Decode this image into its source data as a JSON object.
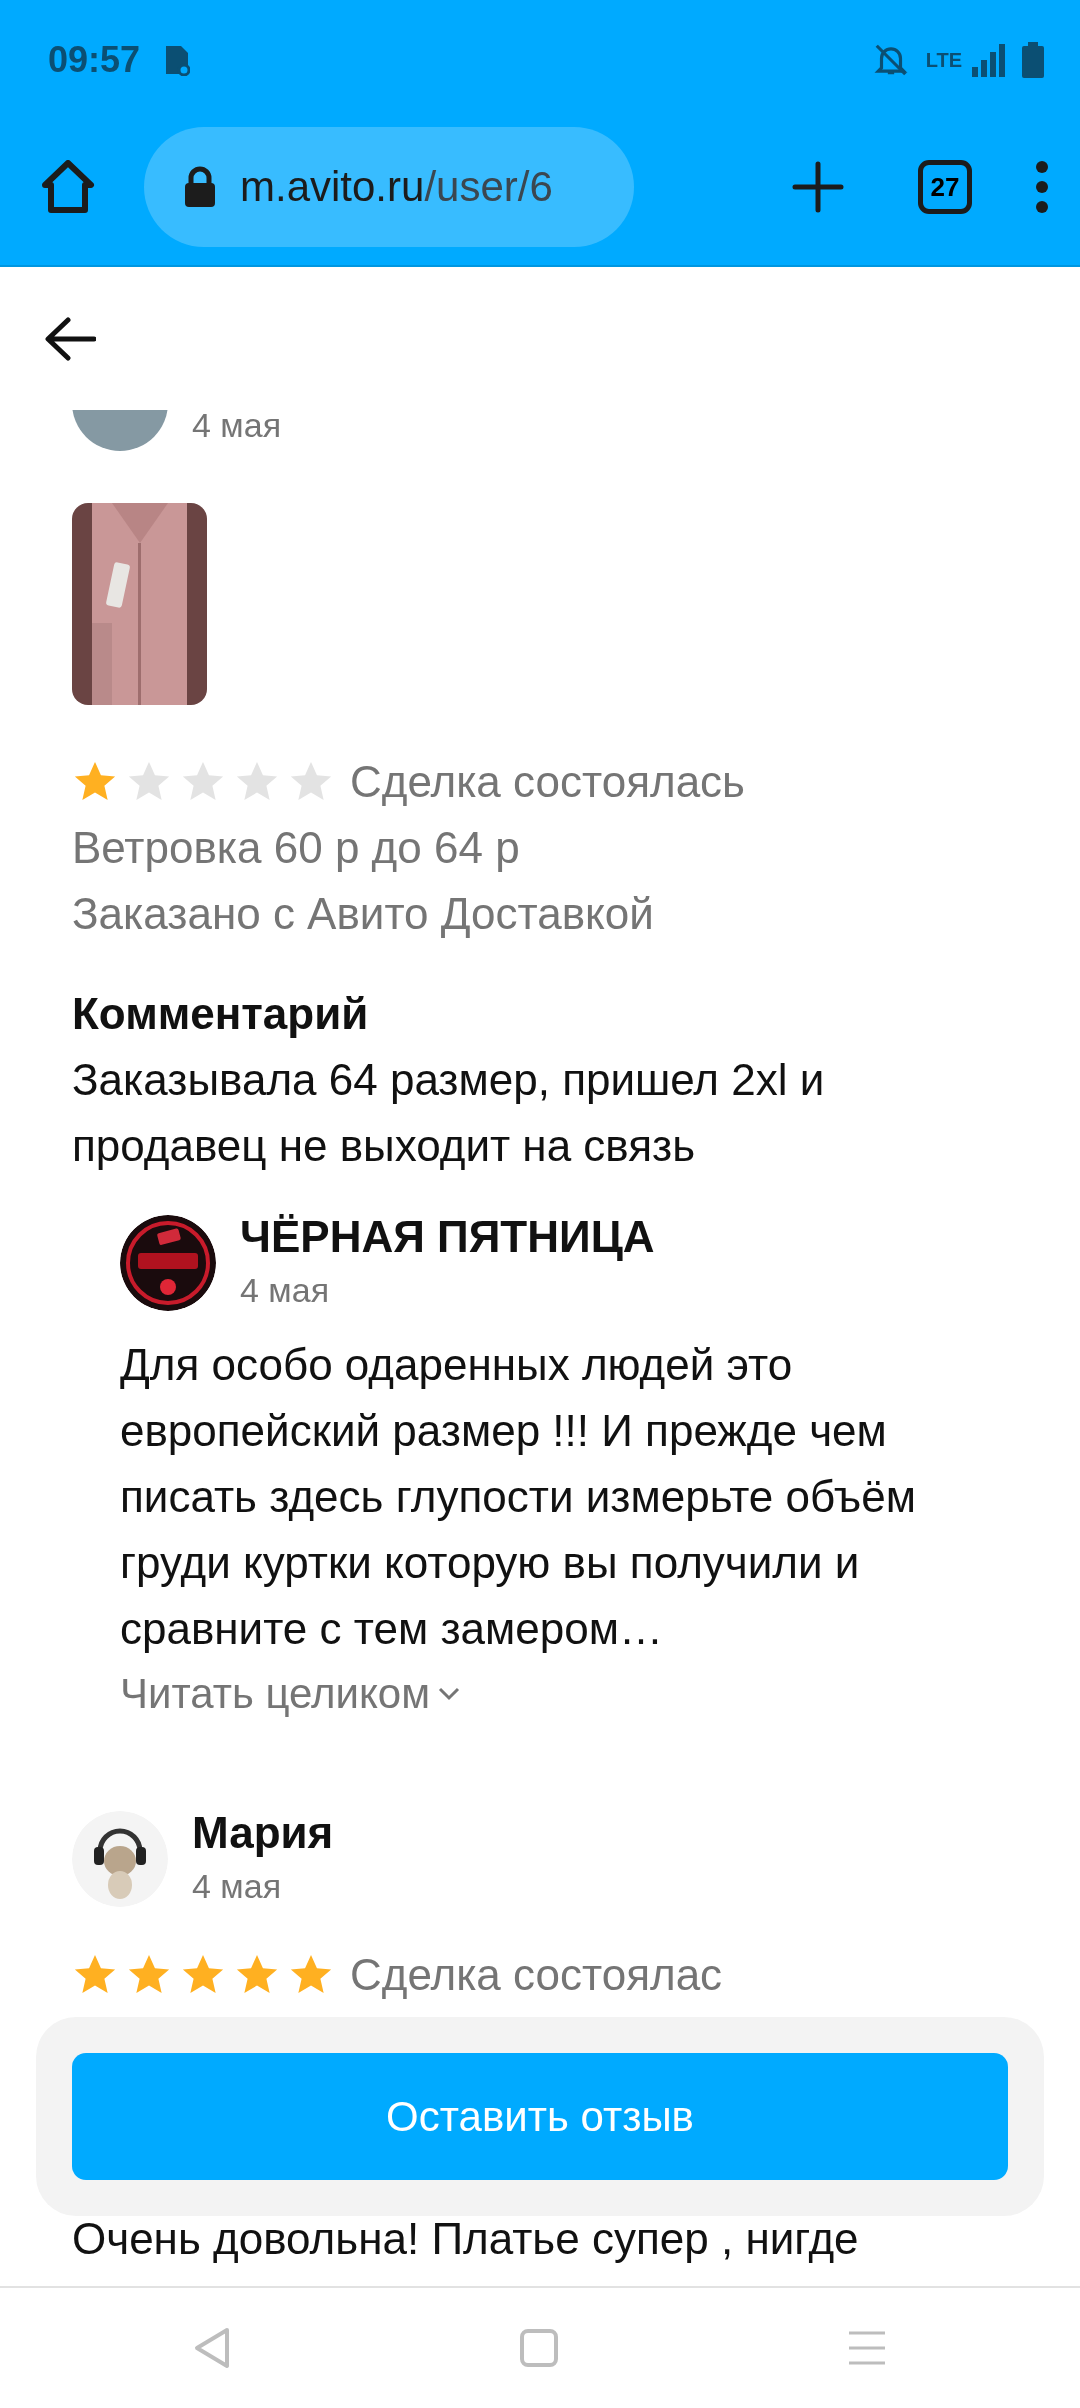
{
  "status_bar": {
    "time": "09:57",
    "network": "LTE"
  },
  "browser": {
    "url_host": "m.avito.ru",
    "url_path": "/user/6",
    "tab_count": "27"
  },
  "reviews": [
    {
      "avatar": {
        "kind": "letter"
      },
      "date": "4 мая",
      "photos": [
        {
          "kind": "picture"
        }
      ],
      "stars": 1,
      "status": "Сделка состоялась",
      "item": "Ветровка 60 р до 64 р",
      "delivery": "Заказано с Авито Доставкой",
      "comment_label": "Комментарий",
      "comment": "Заказывала 64 размер, пришел 2xl и продавец не выходит на связь",
      "reply": {
        "name": "ЧЁРНАЯ ПЯТНИЦА",
        "date": "4 мая",
        "text": "Для особо одаренных людей это европейский размер !!! И прежде чем писать здесь глупости измерьте объём груди куртки которую вы получили и сравните с тем замером…",
        "read_more": "Читать целиком"
      }
    },
    {
      "avatar": {
        "kind": "picture"
      },
      "name": "Мария",
      "date": "4 мая",
      "stars": 5,
      "status": "Сделка состоялас",
      "comment": "Очень довольна! Платье супер , нигде"
    }
  ],
  "action_button": "Оставить отзыв"
}
